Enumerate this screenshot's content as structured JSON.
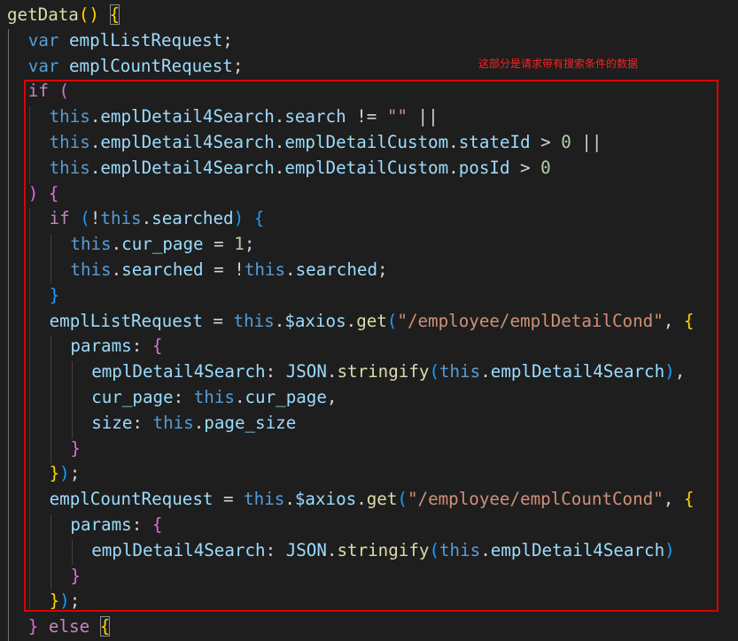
{
  "annotation": {
    "text": "这部分是请求带有搜索条件的数据",
    "color": "#ff2020",
    "box_color": "#e00000"
  },
  "colors": {
    "background": "#1e1e1e",
    "keyword": "#569cd6",
    "control": "#c586c0",
    "function": "#dcdcaa",
    "variable": "#9cdcfe",
    "string": "#ce9178",
    "number": "#b5cea8"
  },
  "code": [
    {
      "indent": 0,
      "tokens": [
        [
          "fn",
          "getData"
        ],
        [
          "b1",
          "()"
        ],
        [
          "p",
          " "
        ],
        [
          "bbox",
          "{"
        ]
      ]
    },
    {
      "indent": 1,
      "tokens": [
        [
          "kw",
          "var"
        ],
        [
          "var",
          " emplListRequest"
        ],
        [
          "p",
          ";"
        ]
      ]
    },
    {
      "indent": 1,
      "tokens": [
        [
          "kw",
          "var"
        ],
        [
          "var",
          " emplCountRequest"
        ],
        [
          "p",
          ";"
        ]
      ]
    },
    {
      "indent": 1,
      "tokens": [
        [
          "ctrl",
          "if"
        ],
        [
          "p",
          " "
        ],
        [
          "b2",
          "("
        ]
      ]
    },
    {
      "indent": 2,
      "tokens": [
        [
          "kw",
          "this"
        ],
        [
          "p",
          "."
        ],
        [
          "var",
          "emplDetail4Search"
        ],
        [
          "p",
          "."
        ],
        [
          "var",
          "search"
        ],
        [
          "p",
          " != "
        ],
        [
          "str",
          "\"\""
        ],
        [
          "p",
          " ||"
        ]
      ]
    },
    {
      "indent": 2,
      "tokens": [
        [
          "kw",
          "this"
        ],
        [
          "p",
          "."
        ],
        [
          "var",
          "emplDetail4Search"
        ],
        [
          "p",
          "."
        ],
        [
          "var",
          "emplDetailCustom"
        ],
        [
          "p",
          "."
        ],
        [
          "var",
          "stateId"
        ],
        [
          "p",
          " > "
        ],
        [
          "num",
          "0"
        ],
        [
          "p",
          " ||"
        ]
      ]
    },
    {
      "indent": 2,
      "tokens": [
        [
          "kw",
          "this"
        ],
        [
          "p",
          "."
        ],
        [
          "var",
          "emplDetail4Search"
        ],
        [
          "p",
          "."
        ],
        [
          "var",
          "emplDetailCustom"
        ],
        [
          "p",
          "."
        ],
        [
          "var",
          "posId"
        ],
        [
          "p",
          " > "
        ],
        [
          "num",
          "0"
        ]
      ]
    },
    {
      "indent": 1,
      "tokens": [
        [
          "b2",
          ")"
        ],
        [
          "p",
          " "
        ],
        [
          "b2",
          "{"
        ]
      ]
    },
    {
      "indent": 2,
      "tokens": [
        [
          "ctrl",
          "if"
        ],
        [
          "p",
          " "
        ],
        [
          "b3",
          "("
        ],
        [
          "p",
          "!"
        ],
        [
          "kw",
          "this"
        ],
        [
          "p",
          "."
        ],
        [
          "var",
          "searched"
        ],
        [
          "b3",
          ")"
        ],
        [
          "p",
          " "
        ],
        [
          "b3",
          "{"
        ]
      ]
    },
    {
      "indent": 3,
      "tokens": [
        [
          "kw",
          "this"
        ],
        [
          "p",
          "."
        ],
        [
          "var",
          "cur_page"
        ],
        [
          "p",
          " = "
        ],
        [
          "num",
          "1"
        ],
        [
          "p",
          ";"
        ]
      ]
    },
    {
      "indent": 3,
      "tokens": [
        [
          "kw",
          "this"
        ],
        [
          "p",
          "."
        ],
        [
          "var",
          "searched"
        ],
        [
          "p",
          " = !"
        ],
        [
          "kw",
          "this"
        ],
        [
          "p",
          "."
        ],
        [
          "var",
          "searched"
        ],
        [
          "p",
          ";"
        ]
      ]
    },
    {
      "indent": 2,
      "tokens": [
        [
          "b3",
          "}"
        ]
      ]
    },
    {
      "indent": 2,
      "tokens": [
        [
          "var",
          "emplListRequest"
        ],
        [
          "p",
          " = "
        ],
        [
          "kw",
          "this"
        ],
        [
          "p",
          "."
        ],
        [
          "var",
          "$axios"
        ],
        [
          "p",
          "."
        ],
        [
          "fn",
          "get"
        ],
        [
          "b3",
          "("
        ],
        [
          "str",
          "\"/employee/emplDetailCond\""
        ],
        [
          "p",
          ", "
        ],
        [
          "b1",
          "{"
        ]
      ]
    },
    {
      "indent": 3,
      "tokens": [
        [
          "var",
          "params"
        ],
        [
          "p",
          ": "
        ],
        [
          "b2",
          "{"
        ]
      ]
    },
    {
      "indent": 4,
      "tokens": [
        [
          "var",
          "emplDetail4Search"
        ],
        [
          "p",
          ": "
        ],
        [
          "var",
          "JSON"
        ],
        [
          "p",
          "."
        ],
        [
          "fn",
          "stringify"
        ],
        [
          "b3",
          "("
        ],
        [
          "kw",
          "this"
        ],
        [
          "p",
          "."
        ],
        [
          "var",
          "emplDetail4Search"
        ],
        [
          "b3",
          ")"
        ],
        [
          "p",
          ","
        ]
      ]
    },
    {
      "indent": 4,
      "tokens": [
        [
          "var",
          "cur_page"
        ],
        [
          "p",
          ": "
        ],
        [
          "kw",
          "this"
        ],
        [
          "p",
          "."
        ],
        [
          "var",
          "cur_page"
        ],
        [
          "p",
          ","
        ]
      ]
    },
    {
      "indent": 4,
      "tokens": [
        [
          "var",
          "size"
        ],
        [
          "p",
          ": "
        ],
        [
          "kw",
          "this"
        ],
        [
          "p",
          "."
        ],
        [
          "var",
          "page_size"
        ]
      ]
    },
    {
      "indent": 3,
      "tokens": [
        [
          "b2",
          "}"
        ]
      ]
    },
    {
      "indent": 2,
      "tokens": [
        [
          "b1",
          "}"
        ],
        [
          "b3",
          ")"
        ],
        [
          "p",
          ";"
        ]
      ]
    },
    {
      "indent": 2,
      "tokens": [
        [
          "var",
          "emplCountRequest"
        ],
        [
          "p",
          " = "
        ],
        [
          "kw",
          "this"
        ],
        [
          "p",
          "."
        ],
        [
          "var",
          "$axios"
        ],
        [
          "p",
          "."
        ],
        [
          "fn",
          "get"
        ],
        [
          "b3",
          "("
        ],
        [
          "str",
          "\"/employee/emplCountCond\""
        ],
        [
          "p",
          ", "
        ],
        [
          "b1",
          "{"
        ]
      ]
    },
    {
      "indent": 3,
      "tokens": [
        [
          "var",
          "params"
        ],
        [
          "p",
          ": "
        ],
        [
          "b2",
          "{"
        ]
      ]
    },
    {
      "indent": 4,
      "tokens": [
        [
          "var",
          "emplDetail4Search"
        ],
        [
          "p",
          ": "
        ],
        [
          "var",
          "JSON"
        ],
        [
          "p",
          "."
        ],
        [
          "fn",
          "stringify"
        ],
        [
          "b3",
          "("
        ],
        [
          "kw",
          "this"
        ],
        [
          "p",
          "."
        ],
        [
          "var",
          "emplDetail4Search"
        ],
        [
          "b3",
          ")"
        ]
      ]
    },
    {
      "indent": 3,
      "tokens": [
        [
          "b2",
          "}"
        ]
      ]
    },
    {
      "indent": 2,
      "tokens": [
        [
          "b1",
          "}"
        ],
        [
          "b3",
          ")"
        ],
        [
          "p",
          ";"
        ]
      ]
    },
    {
      "indent": 1,
      "tokens": [
        [
          "b2",
          "}"
        ],
        [
          "p",
          " "
        ],
        [
          "ctrl",
          "else"
        ],
        [
          "p",
          " "
        ],
        [
          "bbox",
          "{"
        ]
      ]
    }
  ]
}
